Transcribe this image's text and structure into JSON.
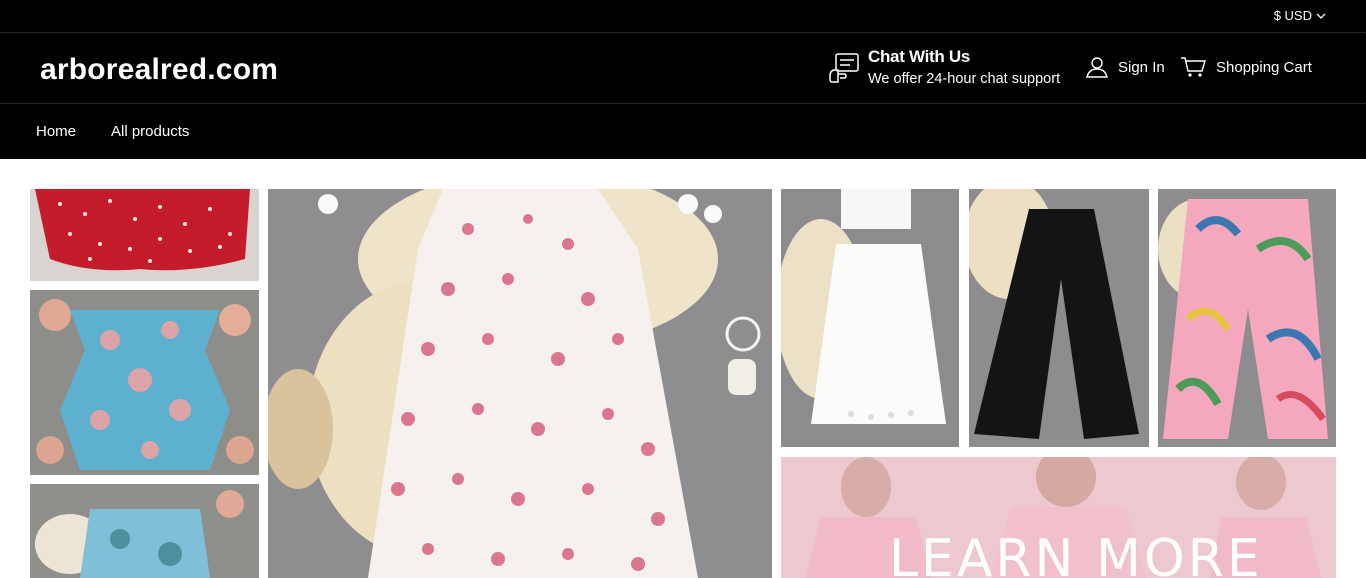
{
  "topbar": {
    "currency_label": "$ USD"
  },
  "header": {
    "logo": "arborealred.com",
    "chat_title": "Chat With Us",
    "chat_subtitle": "We offer 24-hour chat support",
    "signin_label": "Sign In",
    "cart_label": "Shopping Cart"
  },
  "nav": {
    "items": [
      {
        "label": "Home"
      },
      {
        "label": "All products"
      }
    ]
  },
  "banner": {
    "learn_more_label": "LEARN MORE"
  },
  "icons": [
    "chevron-down-icon",
    "chat-icon",
    "user-icon",
    "cart-icon"
  ],
  "colors": {
    "header_bg": "#000000",
    "page_bg": "#ffffff",
    "promo_bg": "#eecad0"
  }
}
